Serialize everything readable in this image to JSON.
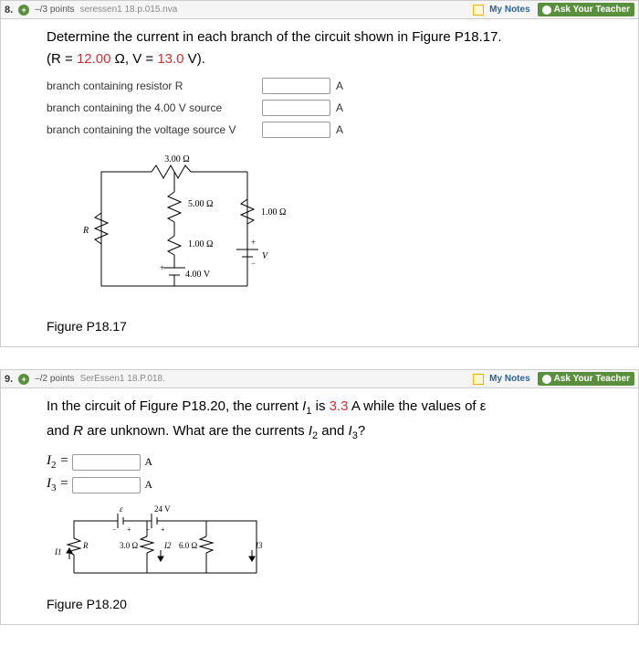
{
  "q8": {
    "number": "8.",
    "points": "–/3 points",
    "ref": "seressen1 18.p.015.nva",
    "notes": "My Notes",
    "ask": "Ask Your Teacher",
    "stem_a": "Determine the current in each branch of the circuit shown in Figure P18.17.",
    "stem_b_pre": "(R = ",
    "R_val": "12.00",
    "stem_b_mid": " Ω, V = ",
    "V_val": "13.0",
    "stem_b_post": " V).",
    "row1_label": "branch containing resistor R",
    "row2_label": "branch containing the 4.00 V source",
    "row3_label": "branch containing the voltage source V",
    "unit": "A",
    "cir_top": "3.00 Ω",
    "cir_r5": "5.00 Ω",
    "cir_r1": "1.00 Ω",
    "cir_r1b": "1.00 Ω",
    "cir_R": "R",
    "cir_src4": "4.00 V",
    "cir_V": "V",
    "figcap": "Figure P18.17"
  },
  "q9": {
    "number": "9.",
    "points": "–/2 points",
    "ref": "SerEssen1 18.P.018.",
    "notes": "My Notes",
    "ask": "Ask Your Teacher",
    "stem_a_pre": "In the circuit of Figure P18.20, the current ",
    "stem_a_I1": "I1",
    "stem_a_mid": " is ",
    "I1_val": "3.3",
    "stem_a_mid2": " A while the values of ε",
    "stem_b": "and R are unknown. What are the currents I2 and I3?",
    "I2_label": "I2 =",
    "I3_label": "I3 =",
    "unit": "A",
    "c_eps": "ε",
    "c_24v": "24 V",
    "c_I1": "I1",
    "c_R": "R",
    "c_3ohm": "3.0 Ω",
    "c_I2": "I2",
    "c_6ohm": "6.0 Ω",
    "c_I3": "I3",
    "figcap": "Figure P18.20"
  }
}
